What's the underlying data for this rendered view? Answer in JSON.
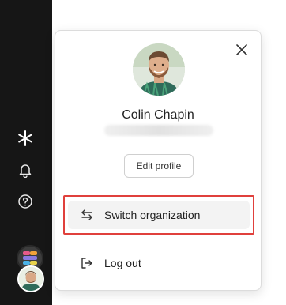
{
  "sidebar": {
    "icons": [
      "asterisk-icon",
      "bell-icon",
      "help-icon"
    ],
    "org_avatar": "org-avatar",
    "user_avatar": "user-avatar"
  },
  "profile_menu": {
    "name": "Colin Chapin",
    "edit_profile_label": "Edit profile",
    "items": [
      {
        "label": "Switch organization",
        "icon": "switch-arrows-icon",
        "highlighted": true
      },
      {
        "label": "Log out",
        "icon": "logout-icon",
        "highlighted": false
      }
    ],
    "close_icon": "close-icon"
  },
  "colors": {
    "sidebar_bg": "#161616",
    "highlight_border": "#e0403c",
    "hover_bg": "#f3f3f3"
  }
}
